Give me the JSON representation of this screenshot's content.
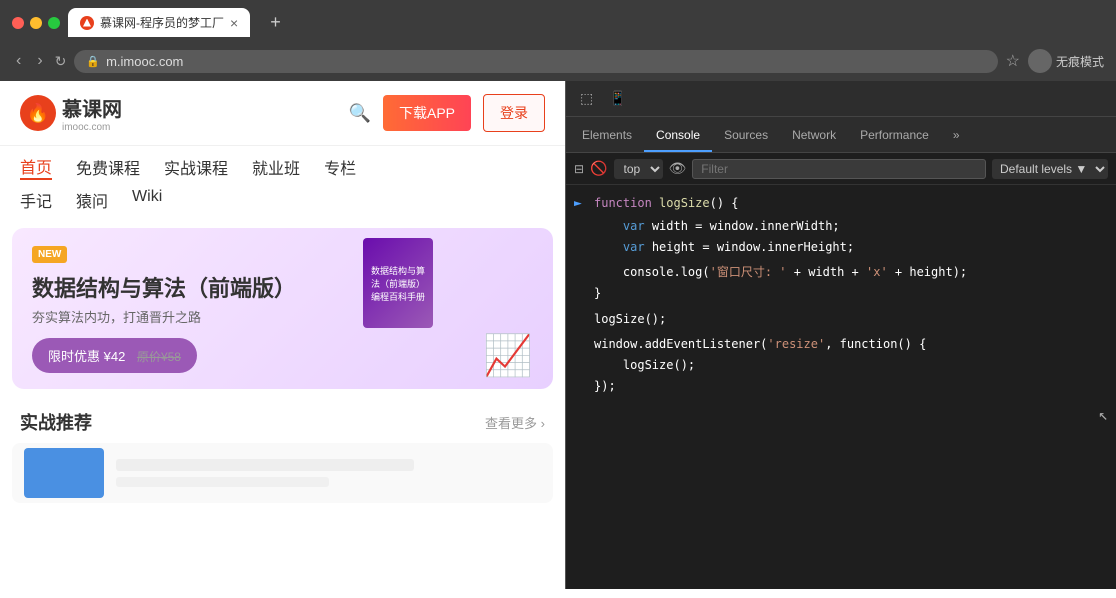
{
  "browser": {
    "traffic_lights": [
      "red",
      "yellow",
      "green"
    ],
    "tab": {
      "title": "慕课网-程序员的梦工厂",
      "close": "×"
    },
    "tab_new": "+",
    "nav": {
      "back": "‹",
      "forward": "›",
      "reload": "↻"
    },
    "address": "m.imooc.com",
    "star": "☆",
    "incognito_label": "无痕模式"
  },
  "website": {
    "logo_cn": "慕课网",
    "logo_en": "imooc.com",
    "download_label": "下载APP",
    "login_label": "登录",
    "nav_items": [
      "首页",
      "免费课程",
      "实战课程",
      "就业班",
      "专栏"
    ],
    "nav_items2": [
      "手记",
      "猿问",
      "Wiki"
    ],
    "banner": {
      "badge": "NEW",
      "title": "数据结构与算法（前端版）",
      "subtitle": "夯实算法内功，打通晋升之路",
      "discount": "限时优惠 ¥42",
      "original": "原价¥58",
      "book_title": "数据结构与算法（前端版）编程百科手册"
    },
    "section": {
      "title": "实战推荐",
      "see_more": "查看更多 ›"
    }
  },
  "devtools": {
    "tabs": [
      "Elements",
      "Console",
      "Sources",
      "Network",
      "Performance"
    ],
    "active_tab": "Console",
    "more_tabs": "»",
    "secondary_bar": {
      "context": "top",
      "filter_placeholder": "Filter",
      "levels": "Default levels"
    },
    "console_code": [
      {
        "prompt": "►",
        "tokens": [
          {
            "text": "function ",
            "class": "kw"
          },
          {
            "text": "logSize",
            "class": "fn-name"
          },
          {
            "text": "() {",
            "class": "sym"
          }
        ]
      },
      {
        "indent": "    ",
        "tokens": [
          {
            "text": "var ",
            "class": "var-kw"
          },
          {
            "text": "width = window.innerWidth;",
            "class": "sym"
          }
        ]
      },
      {
        "indent": "    ",
        "tokens": [
          {
            "text": "var ",
            "class": "var-kw"
          },
          {
            "text": "height = window.innerHeight;",
            "class": "sym"
          }
        ]
      },
      {
        "indent": "",
        "tokens": []
      },
      {
        "indent": "    ",
        "tokens": [
          {
            "text": "console.log(",
            "class": "sym"
          },
          {
            "text": "'窗口尺寸: '",
            "class": "str"
          },
          {
            "text": " + width + ",
            "class": "sym"
          },
          {
            "text": "'x'",
            "class": "str"
          },
          {
            "text": " + height);",
            "class": "sym"
          }
        ]
      },
      {
        "indent": "}",
        "tokens": [
          {
            "text": "",
            "class": "sym"
          }
        ]
      },
      {
        "indent": "",
        "tokens": []
      },
      {
        "indent": "",
        "tokens": [
          {
            "text": "logSize();",
            "class": "sym"
          }
        ]
      },
      {
        "indent": "",
        "tokens": []
      },
      {
        "indent": "",
        "tokens": [
          {
            "text": "window.addEventListener(",
            "class": "sym"
          },
          {
            "text": "'resize'",
            "class": "str"
          },
          {
            "text": ", function() {",
            "class": "sym"
          }
        ]
      },
      {
        "indent": "    ",
        "tokens": [
          {
            "text": "logSize();",
            "class": "sym"
          }
        ]
      },
      {
        "indent": "});",
        "tokens": [
          {
            "text": "",
            "class": "sym"
          }
        ]
      }
    ]
  }
}
